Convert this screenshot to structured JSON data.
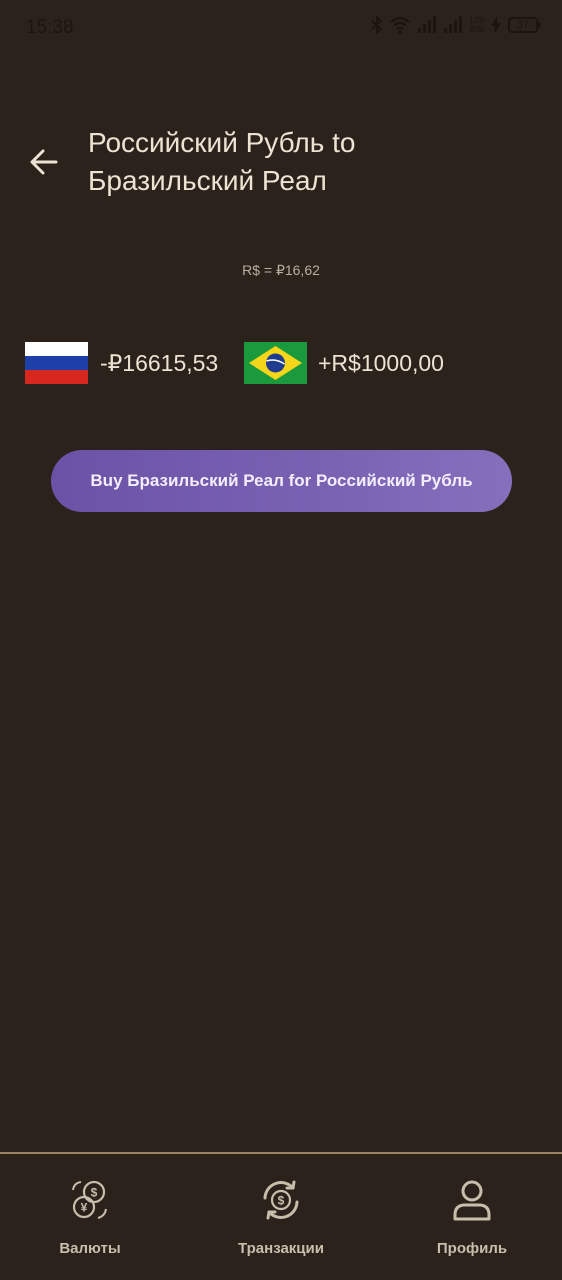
{
  "status_bar": {
    "time": "15:38",
    "net_speed_value": "129",
    "net_speed_unit": "B/S",
    "battery": "37",
    "icons": [
      "bluetooth-icon",
      "wifi-icon",
      "signal-icon",
      "signal-icon",
      "charging-icon",
      "battery-icon"
    ]
  },
  "header": {
    "back_icon": "arrow-left-icon",
    "title_line1": "Российский Рубль to",
    "title_line2": "Бразильский Реал"
  },
  "exchange": {
    "rate": "R$ = ₽16,62",
    "from": {
      "flag": "russia-flag",
      "amount": "-₽16615,53"
    },
    "to": {
      "flag": "brazil-flag",
      "amount": "+R$1000,00"
    }
  },
  "buy_button": {
    "label": "Buy Бразильский Реал for Российский Рубль",
    "color": "#7560b0"
  },
  "bottom_nav": {
    "items": [
      {
        "label": "Валюты",
        "icon": "currency-coins-icon"
      },
      {
        "label": "Транзакции",
        "icon": "exchange-cycle-icon"
      },
      {
        "label": "Профиль",
        "icon": "user-icon"
      }
    ]
  },
  "colors": {
    "background": "#2b221c",
    "text": "#ede3d3",
    "muted": "#b8aea0",
    "nav_border": "#9a8468"
  }
}
